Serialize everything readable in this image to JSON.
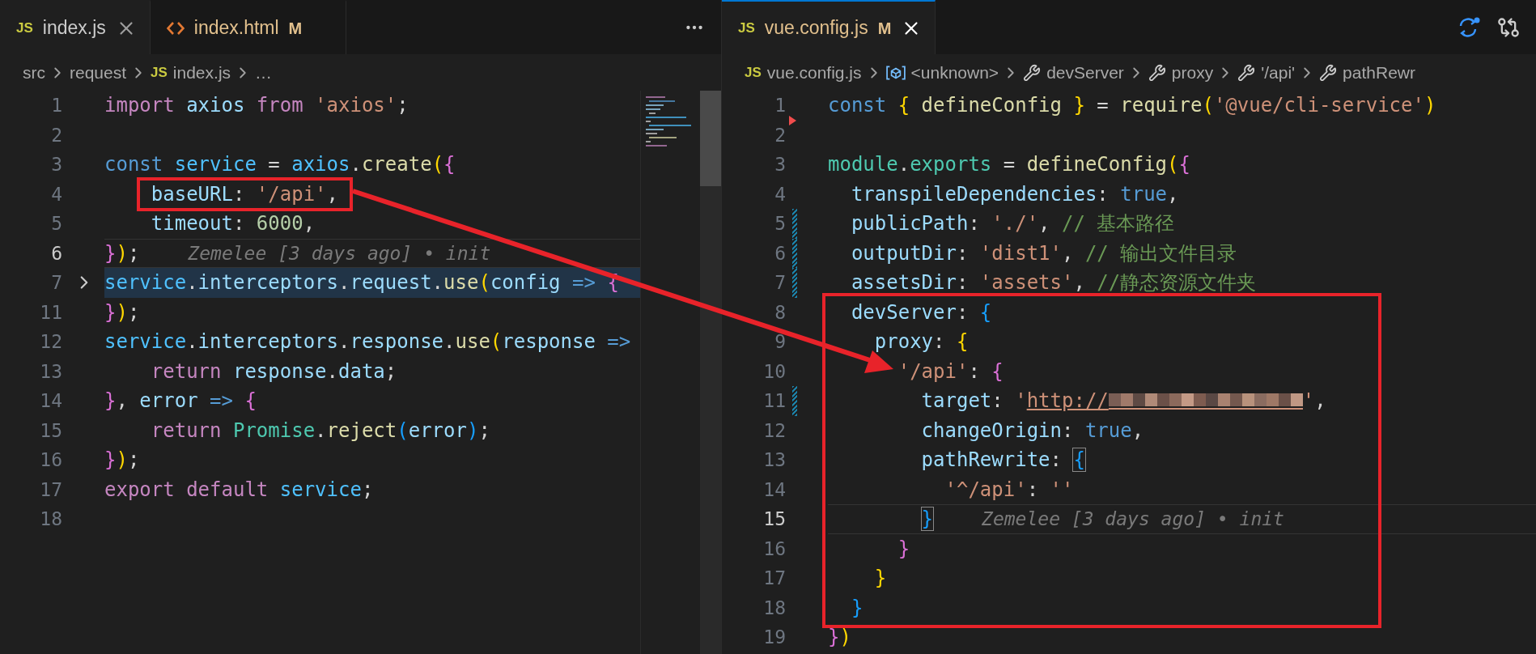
{
  "editors": [
    {
      "focused": false,
      "tabs": [
        {
          "label": "index.js",
          "kind": "script",
          "icon_text": "JS",
          "modified": false,
          "selected": true
        },
        {
          "label": "index.html",
          "kind": "markup",
          "badge": "M",
          "modified": true,
          "selected": false
        }
      ],
      "actions": [
        {
          "kind": "more"
        }
      ],
      "breadcrumbs": [
        {
          "label": "src",
          "kind": "folder"
        },
        {
          "label": "request",
          "kind": "folder"
        },
        {
          "label": "index.js",
          "kind": "script",
          "icon_text": "JS"
        },
        {
          "label": "…",
          "kind": "folder"
        }
      ],
      "lines": [
        {
          "number": "1",
          "kind": "normal",
          "current": false,
          "tokens": [
            {
              "text": "import ",
              "kind": "keyword"
            },
            {
              "text": "axios ",
              "kind": "property"
            },
            {
              "text": "from ",
              "kind": "keyword"
            },
            {
              "text": "'axios'",
              "kind": "string"
            },
            {
              "text": ";",
              "kind": "plain"
            }
          ]
        },
        {
          "number": "2",
          "kind": "normal",
          "current": false
        },
        {
          "number": "3",
          "kind": "normal",
          "current": false,
          "tokens": [
            {
              "text": "const ",
              "kind": "storage"
            },
            {
              "text": "service",
              "kind": "variable"
            },
            {
              "text": " = ",
              "kind": "plain"
            },
            {
              "text": "axios",
              "kind": "variable"
            },
            {
              "text": ".",
              "kind": "plain"
            },
            {
              "text": "create",
              "kind": "function"
            },
            {
              "text": "(",
              "kind": "gold"
            },
            {
              "text": "{",
              "kind": "pink"
            }
          ]
        },
        {
          "number": "4",
          "kind": "normal",
          "current": false,
          "tokens": [
            {
              "text": "    baseURL",
              "kind": "property"
            },
            {
              "text": ": ",
              "kind": "plain"
            },
            {
              "text": "'/api'",
              "kind": "string"
            },
            {
              "text": ",",
              "kind": "plain"
            }
          ]
        },
        {
          "number": "5",
          "kind": "normal",
          "current": false,
          "tokens": [
            {
              "text": "    timeout",
              "kind": "property"
            },
            {
              "text": ": ",
              "kind": "plain"
            },
            {
              "text": "6000",
              "kind": "number"
            },
            {
              "text": ",",
              "kind": "plain"
            }
          ]
        },
        {
          "number": "6",
          "kind": "normal",
          "current": true,
          "blame": "Zemelee [3 days ago] • init",
          "tokens": [
            {
              "text": "}",
              "kind": "pink"
            },
            {
              "text": ")",
              "kind": "gold"
            },
            {
              "text": ";",
              "kind": "plain"
            }
          ]
        },
        {
          "number": "7",
          "kind": "folded",
          "current": false,
          "tokens": [
            {
              "text": "service",
              "kind": "variable"
            },
            {
              "text": ".",
              "kind": "plain"
            },
            {
              "text": "interceptors",
              "kind": "property"
            },
            {
              "text": ".",
              "kind": "plain"
            },
            {
              "text": "request",
              "kind": "property"
            },
            {
              "text": ".",
              "kind": "plain"
            },
            {
              "text": "use",
              "kind": "function"
            },
            {
              "text": "(",
              "kind": "gold"
            },
            {
              "text": "config ",
              "kind": "property"
            },
            {
              "text": "=> ",
              "kind": "storage"
            },
            {
              "text": "{",
              "kind": "pink"
            }
          ]
        },
        {
          "number": "11",
          "kind": "normal",
          "current": false,
          "tokens": [
            {
              "text": "}",
              "kind": "pink"
            },
            {
              "text": ")",
              "kind": "gold"
            },
            {
              "text": ";",
              "kind": "plain"
            }
          ]
        },
        {
          "number": "12",
          "kind": "normal",
          "current": false,
          "tokens": [
            {
              "text": "service",
              "kind": "variable"
            },
            {
              "text": ".",
              "kind": "plain"
            },
            {
              "text": "interceptors",
              "kind": "property"
            },
            {
              "text": ".",
              "kind": "plain"
            },
            {
              "text": "response",
              "kind": "property"
            },
            {
              "text": ".",
              "kind": "plain"
            },
            {
              "text": "use",
              "kind": "function"
            },
            {
              "text": "(",
              "kind": "gold"
            },
            {
              "text": "response ",
              "kind": "property"
            },
            {
              "text": "=>",
              "kind": "storage"
            }
          ]
        },
        {
          "number": "13",
          "kind": "normal",
          "current": false,
          "tokens": [
            {
              "text": "    return ",
              "kind": "keyword"
            },
            {
              "text": "response",
              "kind": "property"
            },
            {
              "text": ".",
              "kind": "plain"
            },
            {
              "text": "data",
              "kind": "property"
            },
            {
              "text": ";",
              "kind": "plain"
            }
          ]
        },
        {
          "number": "14",
          "kind": "normal",
          "current": false,
          "tokens": [
            {
              "text": "}",
              "kind": "pink"
            },
            {
              "text": ", ",
              "kind": "plain"
            },
            {
              "text": "error ",
              "kind": "property"
            },
            {
              "text": "=> ",
              "kind": "storage"
            },
            {
              "text": "{",
              "kind": "pink"
            }
          ]
        },
        {
          "number": "15",
          "kind": "normal",
          "current": false,
          "tokens": [
            {
              "text": "    return ",
              "kind": "keyword"
            },
            {
              "text": "Promise",
              "kind": "class"
            },
            {
              "text": ".",
              "kind": "plain"
            },
            {
              "text": "reject",
              "kind": "function"
            },
            {
              "text": "(",
              "kind": "blue"
            },
            {
              "text": "error",
              "kind": "property"
            },
            {
              "text": ")",
              "kind": "blue"
            },
            {
              "text": ";",
              "kind": "plain"
            }
          ]
        },
        {
          "number": "16",
          "kind": "normal",
          "current": false,
          "tokens": [
            {
              "text": "}",
              "kind": "pink"
            },
            {
              "text": ")",
              "kind": "gold"
            },
            {
              "text": ";",
              "kind": "plain"
            }
          ]
        },
        {
          "number": "17",
          "kind": "normal",
          "current": false,
          "tokens": [
            {
              "text": "export default ",
              "kind": "keyword"
            },
            {
              "text": "service",
              "kind": "variable"
            },
            {
              "text": ";",
              "kind": "plain"
            }
          ]
        },
        {
          "number": "18",
          "kind": "normal",
          "current": false
        }
      ]
    },
    {
      "focused": true,
      "tabs": [
        {
          "label": "vue.config.js",
          "kind": "script",
          "icon_text": "JS",
          "badge": "M",
          "modified": true,
          "selected": true
        }
      ],
      "actions": [
        {
          "kind": "diff"
        },
        {
          "kind": "compare"
        }
      ],
      "breadcrumbs": [
        {
          "label": "vue.config.js",
          "kind": "script",
          "icon_text": "JS"
        },
        {
          "label": "<unknown>",
          "kind": "variable"
        },
        {
          "label": "devServer",
          "kind": "property"
        },
        {
          "label": "proxy",
          "kind": "property"
        },
        {
          "label": "'/api'",
          "kind": "property"
        },
        {
          "label": "pathRewr",
          "kind": "property"
        }
      ],
      "lines": [
        {
          "number": "1",
          "kind": "deleted",
          "current": false,
          "tokens": [
            {
              "text": "const ",
              "kind": "storage"
            },
            {
              "text": "{",
              "kind": "gold"
            },
            {
              "text": " defineConfig ",
              "kind": "function"
            },
            {
              "text": "}",
              "kind": "gold"
            },
            {
              "text": " = ",
              "kind": "plain"
            },
            {
              "text": "require",
              "kind": "function"
            },
            {
              "text": "(",
              "kind": "gold"
            },
            {
              "text": "'@vue/cli-service'",
              "kind": "string"
            },
            {
              "text": ")",
              "kind": "gold"
            }
          ]
        },
        {
          "number": "2",
          "kind": "normal",
          "current": false
        },
        {
          "number": "3",
          "kind": "normal",
          "current": false,
          "tokens": [
            {
              "text": "module",
              "kind": "class"
            },
            {
              "text": ".",
              "kind": "plain"
            },
            {
              "text": "exports",
              "kind": "class"
            },
            {
              "text": " = ",
              "kind": "plain"
            },
            {
              "text": "defineConfig",
              "kind": "function"
            },
            {
              "text": "(",
              "kind": "gold"
            },
            {
              "text": "{",
              "kind": "pink"
            }
          ]
        },
        {
          "number": "4",
          "kind": "normal",
          "current": false,
          "tokens": [
            {
              "text": "  transpileDependencies",
              "kind": "property"
            },
            {
              "text": ": ",
              "kind": "plain"
            },
            {
              "text": "true",
              "kind": "storage"
            },
            {
              "text": ",",
              "kind": "plain"
            }
          ]
        },
        {
          "number": "5",
          "kind": "modified",
          "current": false,
          "tokens": [
            {
              "text": "  publicPath",
              "kind": "property"
            },
            {
              "text": ": ",
              "kind": "plain"
            },
            {
              "text": "'./'",
              "kind": "string"
            },
            {
              "text": ", ",
              "kind": "plain"
            },
            {
              "text": "// 基本路径",
              "kind": "comment"
            }
          ]
        },
        {
          "number": "6",
          "kind": "modified",
          "current": false,
          "tokens": [
            {
              "text": "  outputDir",
              "kind": "property"
            },
            {
              "text": ": ",
              "kind": "plain"
            },
            {
              "text": "'dist1'",
              "kind": "string"
            },
            {
              "text": ", ",
              "kind": "plain"
            },
            {
              "text": "// 输出文件目录",
              "kind": "comment"
            }
          ]
        },
        {
          "number": "7",
          "kind": "modified",
          "current": false,
          "tokens": [
            {
              "text": "  assetsDir",
              "kind": "property"
            },
            {
              "text": ": ",
              "kind": "plain"
            },
            {
              "text": "'assets'",
              "kind": "string"
            },
            {
              "text": ", ",
              "kind": "plain"
            },
            {
              "text": "//静态资源文件夹",
              "kind": "comment"
            }
          ]
        },
        {
          "number": "8",
          "kind": "normal",
          "current": false,
          "tokens": [
            {
              "text": "  devServer",
              "kind": "property"
            },
            {
              "text": ": ",
              "kind": "plain"
            },
            {
              "text": "{",
              "kind": "blue"
            }
          ]
        },
        {
          "number": "9",
          "kind": "normal",
          "current": false,
          "tokens": [
            {
              "text": "    proxy",
              "kind": "property"
            },
            {
              "text": ": ",
              "kind": "plain"
            },
            {
              "text": "{",
              "kind": "gold"
            }
          ]
        },
        {
          "number": "10",
          "kind": "normal",
          "current": false,
          "tokens": [
            {
              "text": "      '/api'",
              "kind": "string"
            },
            {
              "text": ": ",
              "kind": "plain"
            },
            {
              "text": "{",
              "kind": "pink"
            }
          ]
        },
        {
          "number": "11",
          "kind": "modified",
          "current": false,
          "tokens": [
            {
              "text": "        target",
              "kind": "property"
            },
            {
              "text": ": ",
              "kind": "plain"
            },
            {
              "text": "'",
              "kind": "string"
            },
            {
              "text": "http://",
              "kind": "link"
            },
            {
              "kind": "redacted"
            },
            {
              "text": "'",
              "kind": "string"
            },
            {
              "text": ",",
              "kind": "plain"
            }
          ]
        },
        {
          "number": "12",
          "kind": "normal",
          "current": false,
          "tokens": [
            {
              "text": "        changeOrigin",
              "kind": "property"
            },
            {
              "text": ": ",
              "kind": "plain"
            },
            {
              "text": "true",
              "kind": "storage"
            },
            {
              "text": ",",
              "kind": "plain"
            }
          ]
        },
        {
          "number": "13",
          "kind": "normal",
          "current": false,
          "tokens": [
            {
              "text": "        pathRewrite",
              "kind": "property"
            },
            {
              "text": ": ",
              "kind": "plain"
            },
            {
              "text": "{",
              "kind": "matchbrace"
            }
          ]
        },
        {
          "number": "14",
          "kind": "normal",
          "current": false,
          "tokens": [
            {
              "text": "          '^/api'",
              "kind": "string"
            },
            {
              "text": ": ",
              "kind": "plain"
            },
            {
              "text": "''",
              "kind": "string"
            }
          ]
        },
        {
          "number": "15",
          "kind": "normal",
          "current": true,
          "blame": "Zemelee [3 days ago] • init",
          "tokens": [
            {
              "text": "        }",
              "kind": "matchbrace"
            }
          ]
        },
        {
          "number": "16",
          "kind": "normal",
          "current": false,
          "tokens": [
            {
              "text": "      }",
              "kind": "pink"
            }
          ]
        },
        {
          "number": "17",
          "kind": "normal",
          "current": false,
          "tokens": [
            {
              "text": "    }",
              "kind": "gold"
            }
          ]
        },
        {
          "number": "18",
          "kind": "normal",
          "current": false,
          "tokens": [
            {
              "text": "  }",
              "kind": "blue"
            }
          ]
        },
        {
          "number": "19",
          "kind": "normal",
          "current": false,
          "tokens": [
            {
              "text": "}",
              "kind": "pink"
            },
            {
              "text": ")",
              "kind": "gold"
            }
          ]
        }
      ]
    }
  ]
}
